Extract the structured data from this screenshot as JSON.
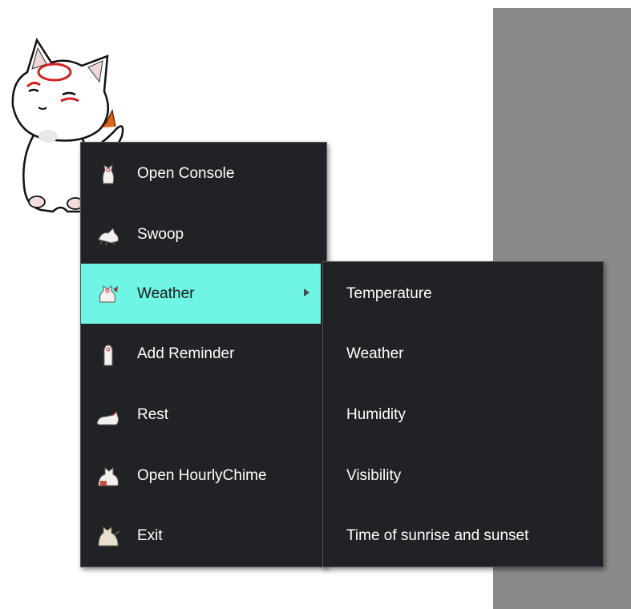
{
  "main_menu": {
    "items": [
      {
        "label": "Open Console",
        "icon": "dog-sitting-icon"
      },
      {
        "label": "Swoop",
        "icon": "dog-running-icon"
      },
      {
        "label": "Weather",
        "icon": "dog-weather-icon",
        "has_submenu": true,
        "active": true
      },
      {
        "label": "Add Reminder",
        "icon": "dog-standing-icon"
      },
      {
        "label": "Rest",
        "icon": "dog-lying-icon"
      },
      {
        "label": "Open HourlyChime",
        "icon": "dog-sleeping-icon"
      },
      {
        "label": "Exit",
        "icon": "dog-leaving-icon"
      }
    ]
  },
  "weather_submenu": {
    "items": [
      {
        "label": "Temperature"
      },
      {
        "label": "Weather"
      },
      {
        "label": "Humidity"
      },
      {
        "label": "Visibility"
      },
      {
        "label": "Time of sunrise and sunset"
      }
    ]
  },
  "colors": {
    "menu_bg": "#202226",
    "highlight": "#6ff5e3",
    "text": "#ffffff",
    "side_panel": "#8a8a8a"
  }
}
